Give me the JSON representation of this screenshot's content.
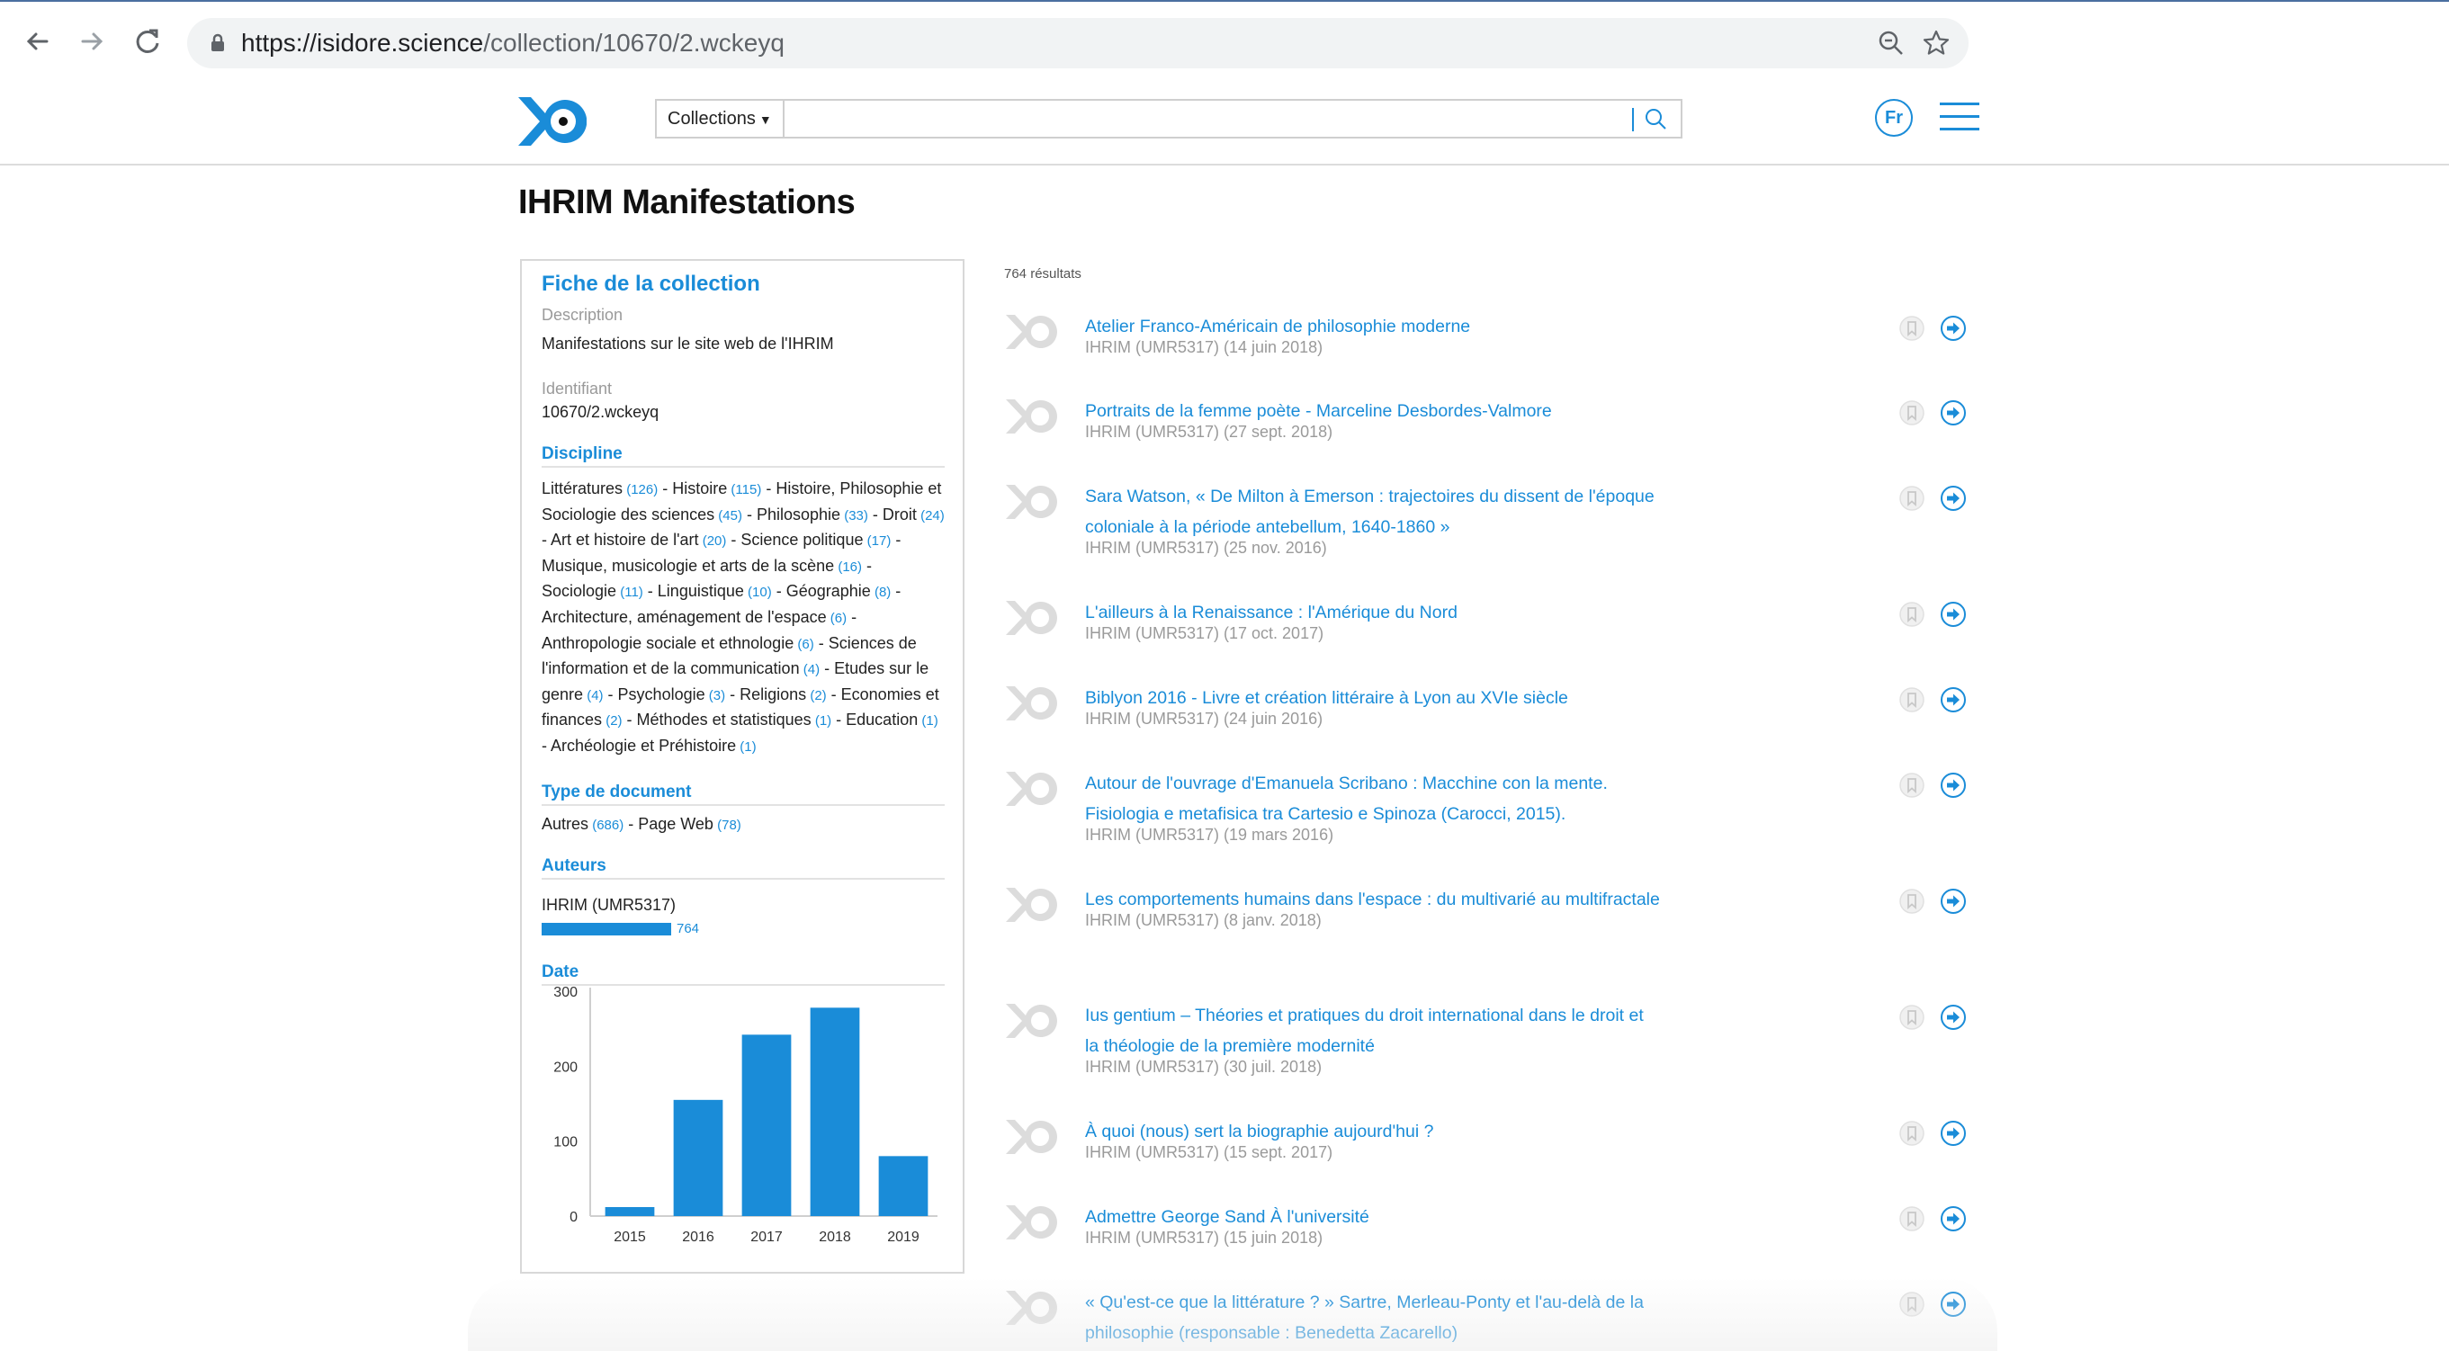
{
  "browser": {
    "url_host": "https://isidore.science",
    "url_path": "/collection/10670/2.wckeyq"
  },
  "header": {
    "collections_label": "Collections",
    "search_placeholder": "",
    "lang_label": "Fr"
  },
  "page": {
    "title": "IHRIM Manifestations"
  },
  "card": {
    "title": "Fiche de la collection",
    "description_label": "Description",
    "description_value": "Manifestations sur le site web de l'IHRIM",
    "identifier_label": "Identifiant",
    "identifier_value": "10670/2.wckeyq",
    "discipline_label": "Discipline",
    "disciplines": [
      {
        "name": "Littératures",
        "count": "(126)"
      },
      {
        "name": "Histoire",
        "count": "(115)"
      },
      {
        "name": "Histoire, Philosophie et Sociologie des sciences",
        "count": "(45)"
      },
      {
        "name": "Philosophie",
        "count": "(33)"
      },
      {
        "name": "Droit",
        "count": "(24)"
      },
      {
        "name": "Art et histoire de l'art",
        "count": "(20)"
      },
      {
        "name": "Science politique",
        "count": "(17)"
      },
      {
        "name": "Musique, musicologie et arts de la scène",
        "count": "(16)"
      },
      {
        "name": "Sociologie",
        "count": "(11)"
      },
      {
        "name": "Linguistique",
        "count": "(10)"
      },
      {
        "name": "Géographie",
        "count": "(8)"
      },
      {
        "name": "Architecture, aménagement de l'espace",
        "count": "(6)"
      },
      {
        "name": "Anthropologie sociale et ethnologie",
        "count": "(6)"
      },
      {
        "name": "Sciences de l'information et de la communication",
        "count": "(4)"
      },
      {
        "name": "Etudes sur le genre",
        "count": "(4)"
      },
      {
        "name": "Psychologie",
        "count": "(3)"
      },
      {
        "name": "Religions",
        "count": "(2)"
      },
      {
        "name": "Economies et finances",
        "count": "(2)"
      },
      {
        "name": "Méthodes et statistiques",
        "count": "(1)"
      },
      {
        "name": "Education",
        "count": "(1)"
      },
      {
        "name": "Archéologie et Préhistoire",
        "count": "(1)"
      }
    ],
    "doctype_label": "Type de document",
    "doctypes": [
      {
        "name": "Autres",
        "count": "(686)"
      },
      {
        "name": "Page Web",
        "count": "(78)"
      }
    ],
    "authors_label": "Auteurs",
    "author_name": "IHRIM (UMR5317)",
    "author_count": "764",
    "author_fraction": 1.0,
    "date_label": "Date"
  },
  "chart_data": {
    "type": "bar",
    "categories": [
      "2015",
      "2016",
      "2017",
      "2018",
      "2019"
    ],
    "values": [
      12,
      155,
      242,
      278,
      80
    ],
    "ylim": [
      0,
      300
    ],
    "yticks": [
      0,
      100,
      200,
      300
    ],
    "color": "#1a8cd8"
  },
  "results": {
    "count_label": "764 résultats",
    "items": [
      {
        "title": "Atelier Franco-Américain de philosophie moderne",
        "meta": "IHRIM (UMR5317) (14 juin 2018)"
      },
      {
        "title": "Portraits de la femme poète - Marceline Desbordes-Valmore",
        "meta": "IHRIM (UMR5317) (27 sept. 2018)"
      },
      {
        "title": "Sara Watson, « De Milton à Emerson : trajectoires du dissent de l'époque coloniale à la période antebellum, 1640-1860 »",
        "meta": "IHRIM (UMR5317) (25 nov. 2016)"
      },
      {
        "title": "L'ailleurs à la Renaissance : l'Amérique du Nord",
        "meta": "IHRIM (UMR5317) (17 oct. 2017)"
      },
      {
        "title": "Biblyon 2016 - Livre et création littéraire à Lyon au XVIe siècle",
        "meta": "IHRIM (UMR5317) (24 juin 2016)"
      },
      {
        "title": "Autour de l'ouvrage d'Emanuela Scribano : Macchine con la mente. Fisiologia e metafisica tra Cartesio e Spinoza (Carocci, 2015).",
        "meta": "IHRIM (UMR5317) (19 mars 2016)"
      },
      {
        "title": "Les comportements humains dans l'espace : du multivarié au multifractale",
        "meta": "IHRIM (UMR5317) (8 janv. 2018)"
      },
      {
        "title": "Ius gentium – Théories et pratiques du droit international dans le droit et la théologie de la première modernité",
        "meta": "IHRIM (UMR5317) (30 juil. 2018)"
      },
      {
        "title": "À quoi (nous) sert la biographie aujourd'hui ?",
        "meta": "IHRIM (UMR5317) (15 sept. 2017)"
      },
      {
        "title": "Admettre George Sand À l'université",
        "meta": "IHRIM (UMR5317) (15 juin 2018)"
      },
      {
        "title": "« Qu'est-ce que la littérature ? » Sartre, Merleau-Ponty et l'au-delà de la philosophie (responsable : Benedetta Zacarello)",
        "meta": ""
      }
    ]
  }
}
